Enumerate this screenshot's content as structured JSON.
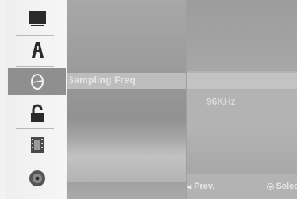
{
  "menu": {
    "items": [
      {
        "name": "tv-icon",
        "selected": false
      },
      {
        "name": "language-icon",
        "selected": false
      },
      {
        "name": "audio-icon",
        "selected": true
      },
      {
        "name": "lock-icon",
        "selected": false
      },
      {
        "name": "film-icon",
        "selected": false
      },
      {
        "name": "disc-icon",
        "selected": false
      }
    ]
  },
  "option": {
    "label": "Sampling Freq."
  },
  "value": {
    "current": "96KHz"
  },
  "footer": {
    "prev_label": "Prev.",
    "select_label": "Select"
  },
  "colors": {
    "highlight": "#8f8f8f",
    "panel": "#b3b3b3",
    "text": "#e4e4e4"
  }
}
